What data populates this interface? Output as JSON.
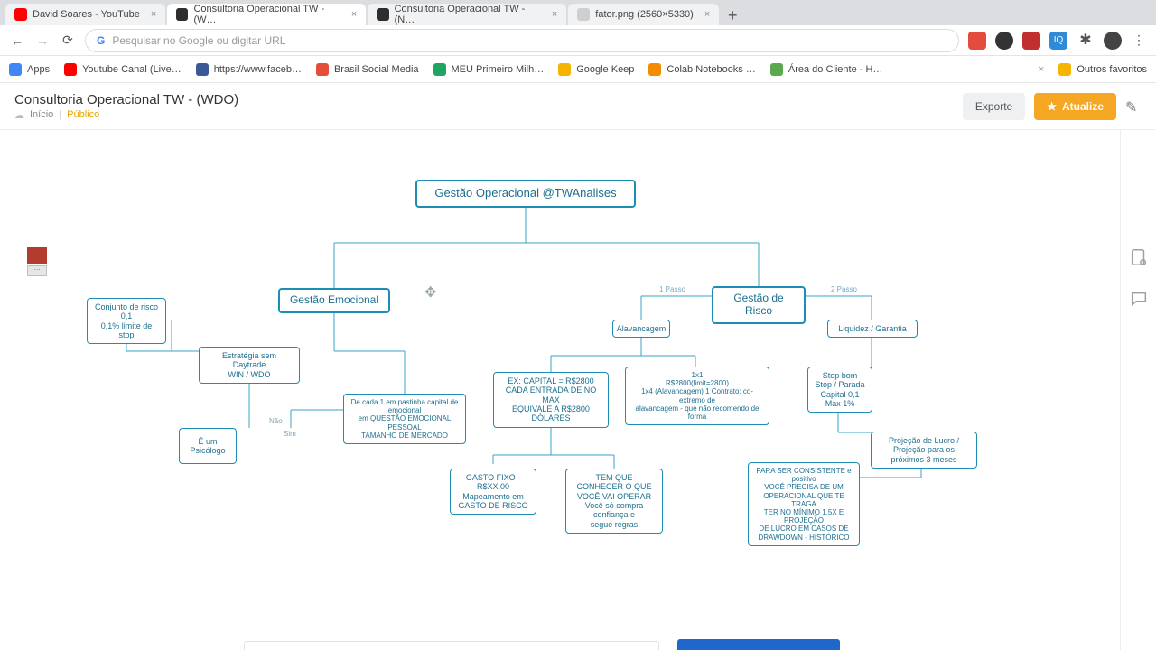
{
  "browser": {
    "tabs": [
      {
        "label": "David Soares - YouTube",
        "favColor": "#ff0000"
      },
      {
        "label": "Consultoria Operacional TW - (W…",
        "favColor": "#2e2e2e",
        "active": true
      },
      {
        "label": "Consultoria Operacional TW - (N…",
        "favColor": "#2e2e2e"
      },
      {
        "label": "fator.png (2560×5330)",
        "favColor": "#cfcfcf"
      }
    ],
    "omnibox_placeholder": "Pesquisar no Google ou digitar URL",
    "bookmarks": [
      {
        "label": "Apps",
        "color": "#4285f4"
      },
      {
        "label": "Youtube Canal (Live…",
        "color": "#ff0000"
      },
      {
        "label": "https://www.faceb…",
        "color": "#3b5998"
      },
      {
        "label": "Brasil Social Media",
        "color": "#e44d3a"
      },
      {
        "label": "MEU Primeiro Milh…",
        "color": "#1fa463"
      },
      {
        "label": "Google Keep",
        "color": "#f5b400"
      },
      {
        "label": "Colab Notebooks …",
        "color": "#f48b00"
      },
      {
        "label": "Área do Cliente - H…",
        "color": "#5aa84f"
      },
      {
        "label": "Outros favoritos",
        "color": "#f5b400"
      }
    ]
  },
  "app": {
    "title": "Consultoria Operacional TW - (WDO)",
    "home": "Início",
    "visibility": "Público",
    "export": "Exporte",
    "upgrade": "Atualize"
  },
  "diagram": {
    "root": "Gestão Operacional @TWAnalises",
    "branch_left": "Gestão Emocional",
    "branch_right": "Gestão de Risco",
    "conn_1pass": "1 Passo",
    "conn_2pass": "2 Passo",
    "n_alavancagem": "Alavancagem",
    "n_liquidez": "Liquidez / Garantia",
    "n_exemplo_cap": "EX: CAPITAL = R$2800\nCADA ENTRADA DE NO MAX\nEQUIVALE A R$2800 DÓLARES",
    "n_lote": "1x1\nR$2800(limit=2800)\n1x4 (Alavancagem) 1 Contrato: co-extremo de\nalavancagem - que não recomendo de forma",
    "n_stop": "Stop bom\nStop / Parada\nCapital 0,1 Max 1%",
    "n_conjunto": "Conjunto de risco 0,1\n0,1% limite de stop",
    "n_estrategia": "Estratégia sem Daytrade\nWIN / WDO",
    "n_decada": "De cada 1 em pastinha capital de emocional\nem QUESTÃO EMOCIONAL PESSOAL\nTAMANHO DE MERCADO",
    "n_sim": "Sim",
    "n_nao": "Não",
    "n_psico": "É um Psicólogo",
    "n_gasto": "GASTO FIXO - R$XX,00\nMapeamento em\nGASTO DE RISCO",
    "n_confianca": "TEM QUE CONHECER O QUE\nVOCÊ VAI OPERAR\nVocê só compra confiança e\nsegue regras",
    "n_consistente": "PARA SER CONSISTENTE e positivo\nVOCÊ PRECISA DE UM\nOPERACIONAL QUE TE TRAGA\nTER NO MÍNIMO 1,5X E PROJEÇÃO\nDE LUCRO EM CASOS DE\nDRAWDOWN - HISTÓRICO",
    "n_proj": "Projeção de Lucro / Projeção para os\npróximos 3 meses"
  }
}
